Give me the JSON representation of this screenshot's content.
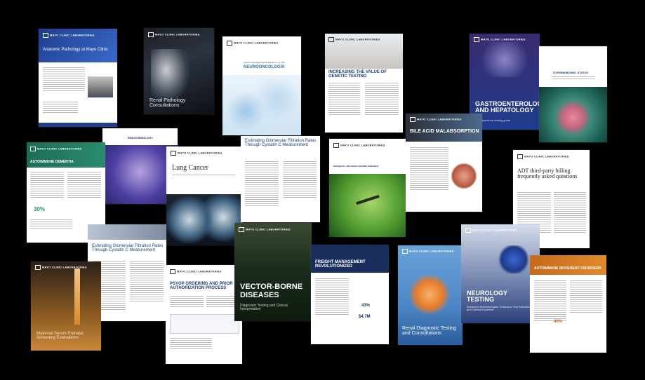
{
  "logo_text": "MAYO CLINIC LABORATORIES",
  "cards": {
    "anatomic": {
      "title": "Anatomic Pathology at Mayo Clinic"
    },
    "renal_path": {
      "title": "Renal Pathology Consultations"
    },
    "neuro_es": {
      "kicker": "CASOS INFORMATIVOS DE MAYO CLINIC",
      "title": "NEUROONCOLOGÍA"
    },
    "genetic": {
      "title": "INCREASING THE VALUE OF GENETIC TESTING"
    },
    "gastro": {
      "title": "GASTROENTEROLOGY AND HEPATOLOGY",
      "subtitle": "A full spectrum testing guide"
    },
    "urine": {
      "title": "UTERINE/BOWEL STATUS"
    },
    "endocrinology": {
      "title": "ENDOCRINOLOGY"
    },
    "autoimmune_dementia": {
      "title": "AUTOIMMUNE DEMENTIA",
      "stat": "30%"
    },
    "lung": {
      "title": "Lung Cancer"
    },
    "egfr_top": {
      "title": "Estimating Glomerular Filtration Rates Through Cystatin C Measurement"
    },
    "mosquito": {
      "title": "MOSQUITO- AND INSECT-BORNE DISEASES"
    },
    "bile": {
      "title": "BILE ACID MALABSORPTION"
    },
    "adt": {
      "title": "ADT third-party billing frequently asked questions"
    },
    "egfr_bottom": {
      "title": "Estimating Glomerular Filtration Rates Through Cystatin C Measurement"
    },
    "psyop": {
      "title": "PSYOP ORDERING AND PRIOR AUTHORIZATION PROCESS"
    },
    "vector": {
      "title": "VECTOR-BORNE DISEASES",
      "subtitle": "Diagnostic Testing and Clinical Interpretation"
    },
    "freight": {
      "title": "FREIGHT MANAGEMENT REVOLUTIONIZED",
      "stat1": "43%",
      "stat2": "$4.7M"
    },
    "renal_diag": {
      "title": "Renal Diagnostic Testing and Consultations"
    },
    "neurology": {
      "title": "NEUROLOGY TESTING",
      "subtitle": "Advanced Methodologies, Extensive Test Selection, and Clinical Expertise"
    },
    "movement": {
      "title": "AUTOIMMUNE MOVEMENT DISORDERS",
      "stat": "40%"
    },
    "maternal": {
      "title": "Maternal Serum Prenatal Screening Evaluations"
    }
  }
}
